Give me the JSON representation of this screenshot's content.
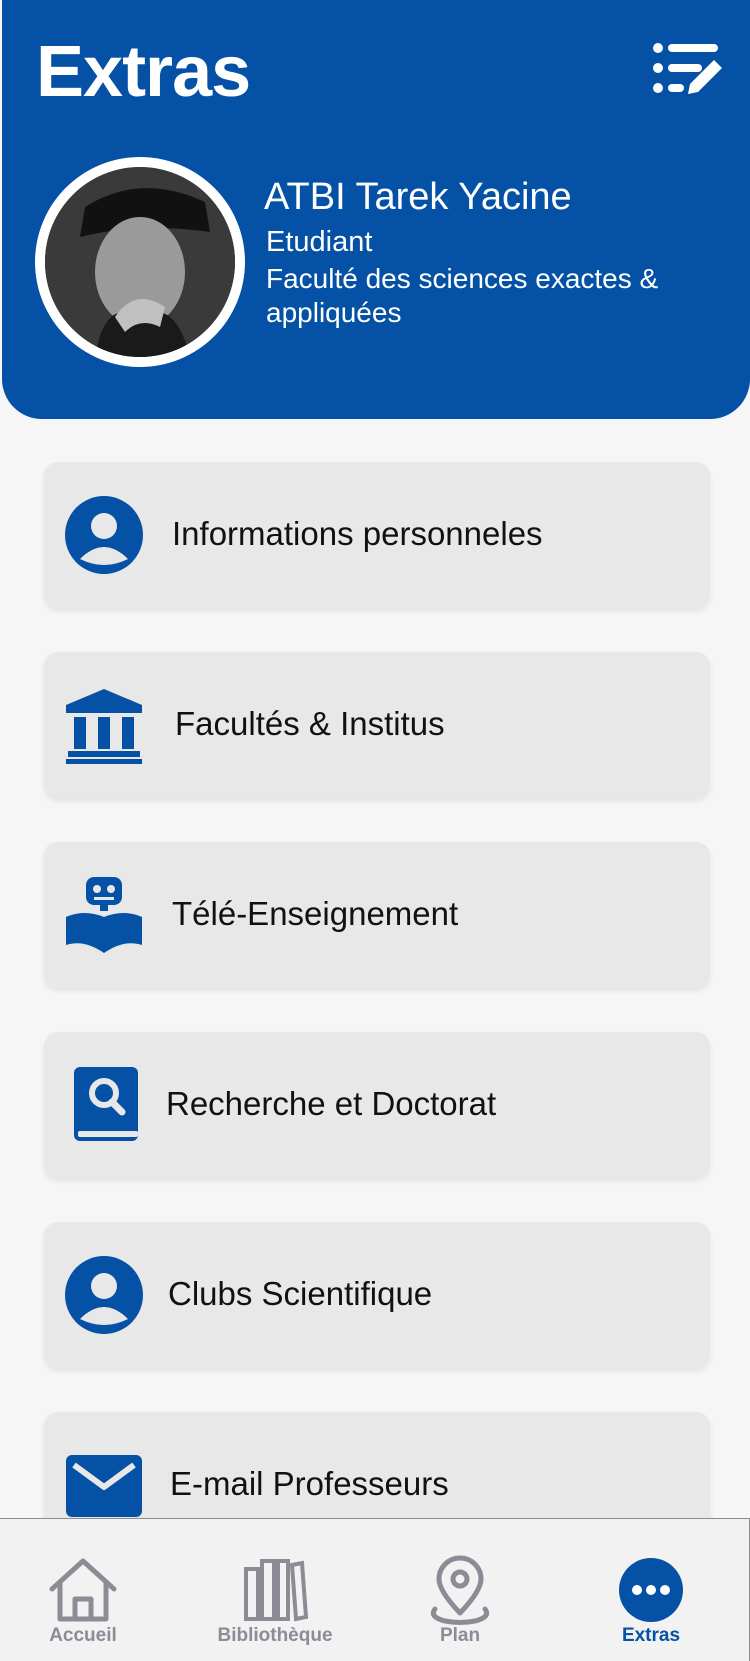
{
  "header": {
    "title": "Extras",
    "edit_icon": "list-edit-icon",
    "background_color": "#0451a5"
  },
  "profile": {
    "name": "ATBI Tarek Yacine",
    "role": "Etudiant",
    "faculty": "Faculté des sciences exactes & appliquées"
  },
  "menu": {
    "items": [
      {
        "label": "Informations personneles",
        "icon": "user-icon"
      },
      {
        "label": "Facultés & Institus",
        "icon": "institution-icon"
      },
      {
        "label": "Télé-Enseignement",
        "icon": "robot-reading-icon"
      },
      {
        "label": "Recherche et Doctorat",
        "icon": "search-book-icon"
      },
      {
        "label": "Clubs Scientifique",
        "icon": "user-icon"
      },
      {
        "label": "E-mail Professeurs",
        "icon": "mail-icon"
      }
    ]
  },
  "nav": {
    "items": [
      {
        "label": "Accueil",
        "icon": "home-icon",
        "active": false
      },
      {
        "label": "Bibliothèque",
        "icon": "library-icon",
        "active": false
      },
      {
        "label": "Plan",
        "icon": "map-pin-icon",
        "active": false
      },
      {
        "label": "Extras",
        "icon": "more-icon",
        "active": true
      }
    ]
  },
  "colors": {
    "primary": "#0451a5",
    "card": "#e8e8e8",
    "nav_inactive": "#8c8c96"
  }
}
